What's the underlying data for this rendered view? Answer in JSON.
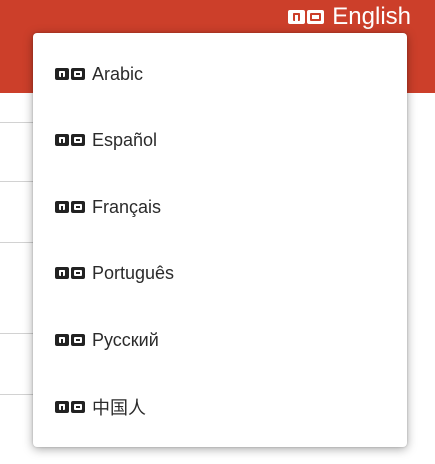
{
  "header": {
    "current_language": "English",
    "icon": "language-translate-icon",
    "accent_color": "#cc3f2a"
  },
  "dropdown": {
    "items": [
      {
        "label": "Arabic",
        "icon": "language-translate-icon"
      },
      {
        "label": "Español",
        "icon": "language-translate-icon"
      },
      {
        "label": "Français",
        "icon": "language-translate-icon"
      },
      {
        "label": "Português",
        "icon": "language-translate-icon"
      },
      {
        "label": "Русский",
        "icon": "language-translate-icon"
      },
      {
        "label": "中国人",
        "icon": "language-translate-icon"
      }
    ]
  }
}
